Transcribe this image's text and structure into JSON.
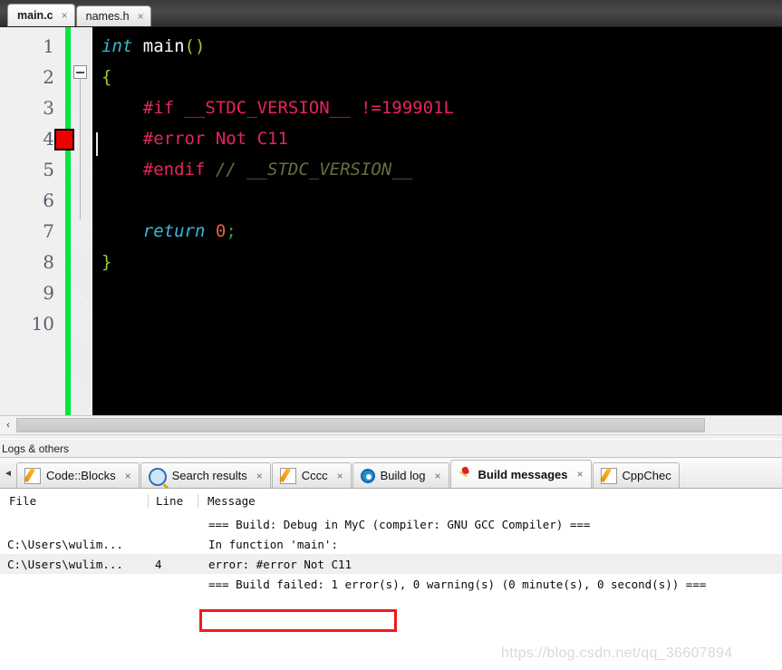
{
  "editor": {
    "tabs": [
      {
        "label": "main.c",
        "active": true,
        "close": "×"
      },
      {
        "label": "names.h",
        "active": false,
        "close": "×"
      }
    ],
    "line_numbers": [
      "1",
      "2",
      "3",
      "4",
      "5",
      "6",
      "7",
      "8",
      "9",
      "10"
    ],
    "error_line": 4,
    "code": {
      "l1_type": "int",
      "l1_space": " ",
      "l1_fn": "main",
      "l1_paren": "()",
      "l2_brace": "{",
      "l3": "    #if __STDC_VERSION__ !=199901L",
      "l4": "    #error Not C11",
      "l5_prep": "    #endif ",
      "l5_comment": "// __STDC_VERSION__",
      "l7_indent": "    ",
      "l7_return": "return",
      "l7_space": " ",
      "l7_num": "0",
      "l7_semi": ";",
      "l8_brace": "}"
    },
    "hscroll_left_arrow": "‹"
  },
  "logs": {
    "title": "Logs & others",
    "scroll_left_arrow": "◄",
    "tabs": [
      {
        "label": "Code::Blocks",
        "icon": "pencil-icon",
        "active": false,
        "close": "×"
      },
      {
        "label": "Search results",
        "icon": "magnifier-icon",
        "active": false,
        "close": "×"
      },
      {
        "label": "Cccc",
        "icon": "pencil-icon",
        "active": false,
        "close": "×"
      },
      {
        "label": "Build log",
        "icon": "gear-icon",
        "active": false,
        "close": "×"
      },
      {
        "label": "Build messages",
        "icon": "pin-icon",
        "active": true,
        "close": "×"
      },
      {
        "label": "CppChec",
        "icon": "pencil-icon",
        "active": false,
        "close": ""
      }
    ],
    "columns": {
      "file": "File",
      "line": "Line",
      "message": "Message"
    },
    "rows": [
      {
        "file": "",
        "line": "",
        "message": "=== Build: Debug in MyC (compiler: GNU GCC Compiler) ===",
        "selected": false
      },
      {
        "file": "C:\\Users\\wulim...",
        "line": "",
        "message": "In function 'main':",
        "selected": false
      },
      {
        "file": "C:\\Users\\wulim...",
        "line": "4",
        "message": "error: #error Not C11",
        "selected": true
      },
      {
        "file": "",
        "line": "",
        "message": "=== Build failed: 1 error(s), 0 warning(s) (0 minute(s), 0 second(s)) ===",
        "selected": false
      }
    ]
  },
  "watermark": "https://blog.csdn.net/qq_36607894",
  "colors": {
    "error_marker": "#ef0000",
    "change_bar": "#00e83c",
    "annotation_box": "#ee1b1b",
    "keyword": "#39b7d4",
    "preprocessor": "#e8245c",
    "comment": "#6b6b42",
    "number": "#e06040",
    "bracket": "#9acd32"
  }
}
